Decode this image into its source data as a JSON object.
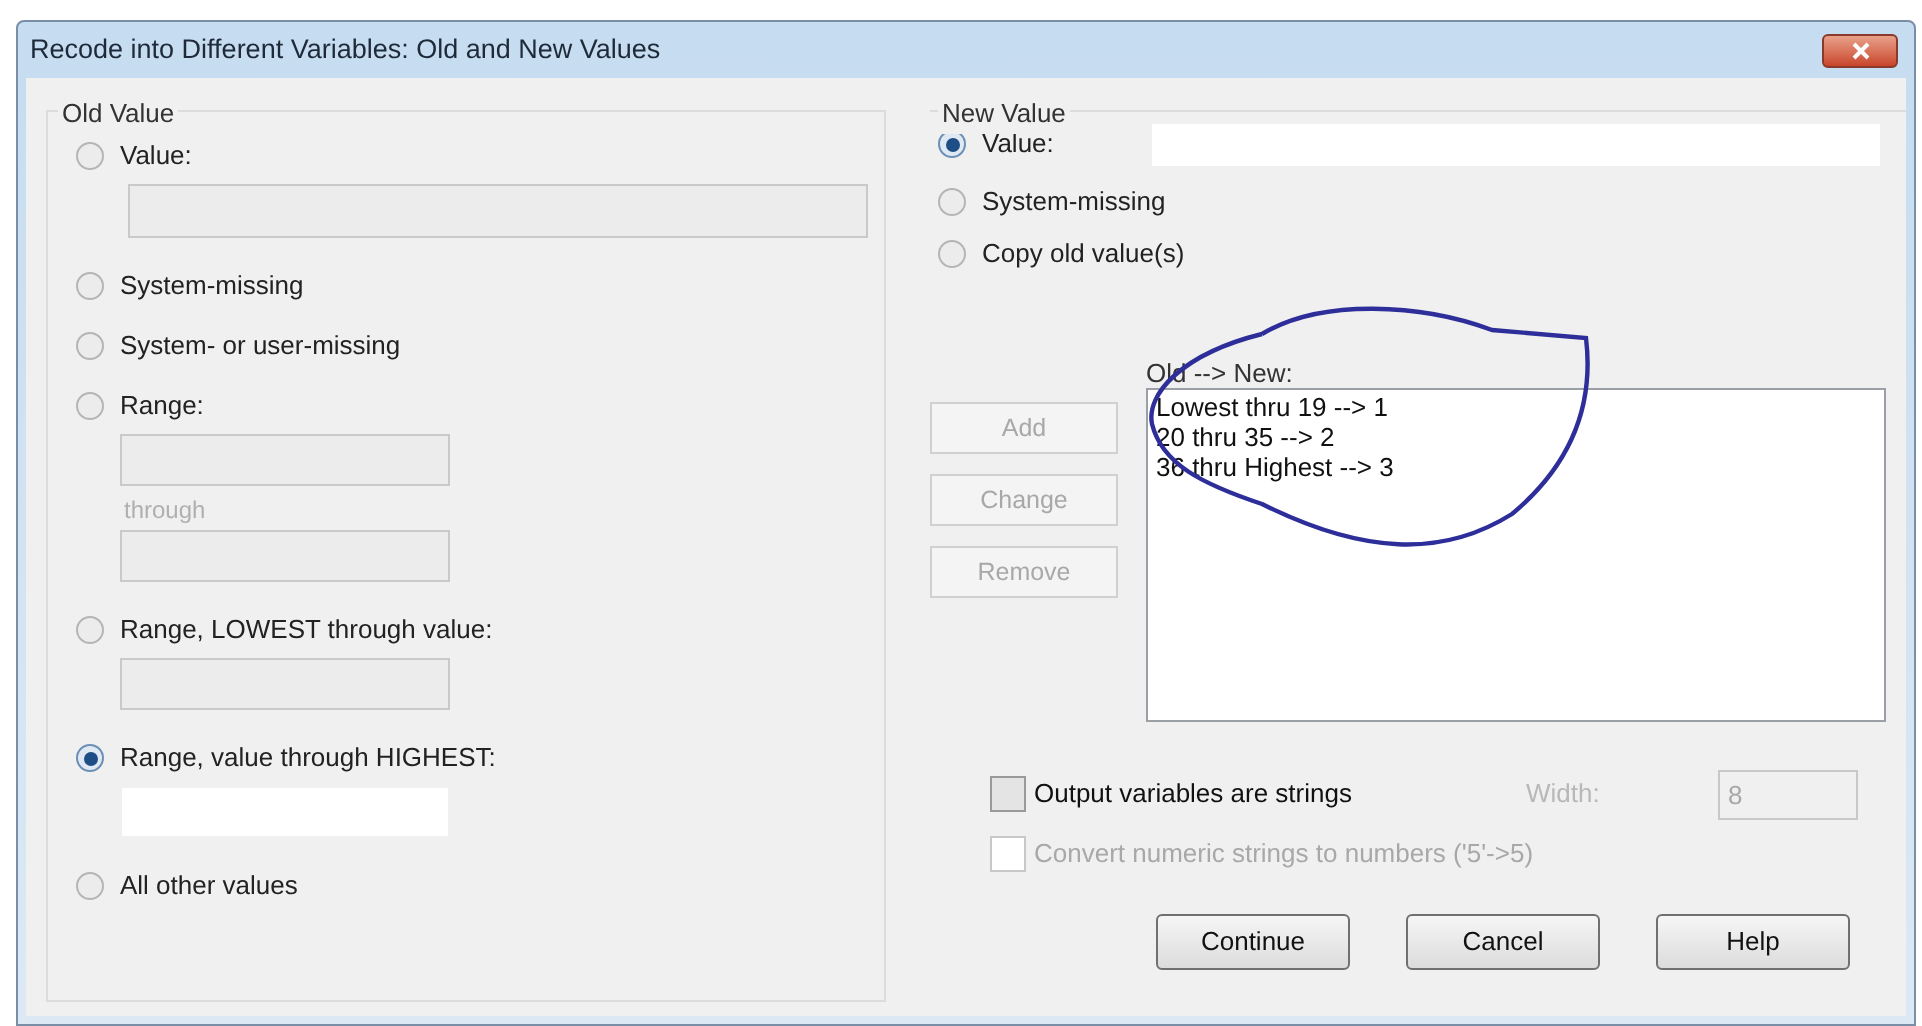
{
  "window": {
    "title": "Recode into Different Variables: Old and New Values"
  },
  "old_value": {
    "label": "Old Value",
    "options": [
      {
        "kind": "value",
        "label": "Value:",
        "selected": false,
        "fields": [
          {
            "enabled": false
          }
        ]
      },
      {
        "kind": "plain",
        "label": "System-missing",
        "selected": false
      },
      {
        "kind": "plain",
        "label": "System- or user-missing",
        "selected": false
      },
      {
        "kind": "range",
        "label": "Range:",
        "selected": false,
        "through_label": "through",
        "fields": [
          {
            "enabled": false
          },
          {
            "enabled": false
          }
        ]
      },
      {
        "kind": "value",
        "label": "Range, LOWEST through value:",
        "selected": false,
        "fields": [
          {
            "enabled": false
          }
        ]
      },
      {
        "kind": "value",
        "label": "Range, value through HIGHEST:",
        "selected": true,
        "fields": [
          {
            "enabled": true
          }
        ]
      },
      {
        "kind": "plain",
        "label": "All other values",
        "selected": false
      }
    ]
  },
  "new_value": {
    "label": "New Value",
    "options": [
      {
        "kind": "inline_field",
        "label": "Value:",
        "selected": true,
        "field": {
          "enabled": true
        }
      },
      {
        "kind": "plain",
        "label": "System-missing",
        "selected": false
      },
      {
        "kind": "plain",
        "label": "Copy old value(s)",
        "selected": false
      }
    ]
  },
  "list_buttons": [
    {
      "label": "Add",
      "disabled": true
    },
    {
      "label": "Change",
      "disabled": true
    },
    {
      "label": "Remove",
      "disabled": true
    }
  ],
  "mapping_list": {
    "label": "Old --> New:",
    "items": [
      "Lowest thru 19 --> 1",
      "20 thru 35 --> 2",
      "36 thru Highest --> 3"
    ]
  },
  "output_strings": {
    "label": "Output variables are strings",
    "checked": false,
    "disabled": false,
    "width_label": "Width:",
    "width_value": "8",
    "width_disabled": true
  },
  "convert_numeric": {
    "label": "Convert numeric strings to numbers ('5'->5)",
    "checked": false,
    "disabled": true
  },
  "buttons": [
    {
      "label": "Continue"
    },
    {
      "label": "Cancel"
    },
    {
      "label": "Help"
    }
  ]
}
